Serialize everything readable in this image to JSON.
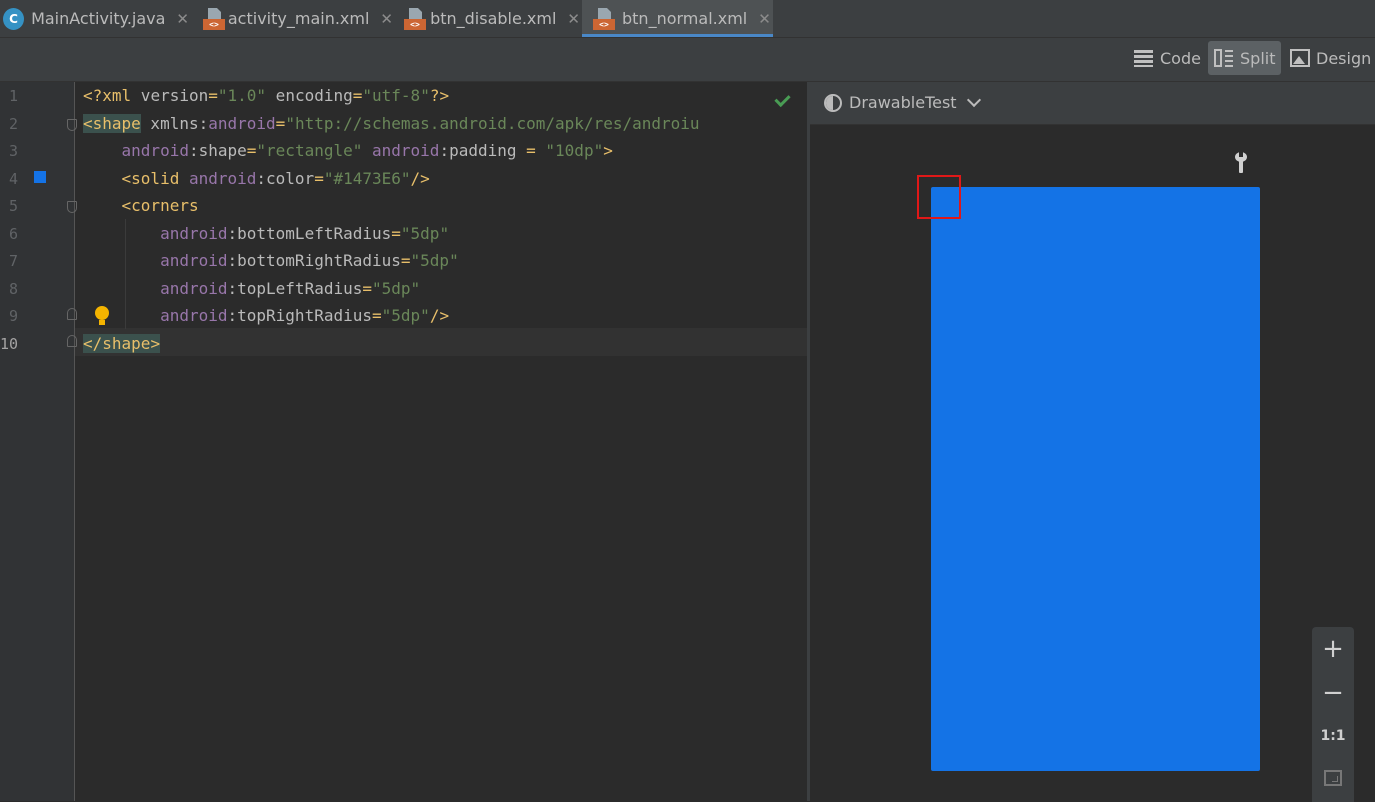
{
  "tabs": [
    {
      "label": "MainActivity.java",
      "icon": "java-class-icon",
      "icon_text": "C"
    },
    {
      "label": "activity_main.xml",
      "icon": "xml-file-icon",
      "icon_text": "<>"
    },
    {
      "label": "btn_disable.xml",
      "icon": "xml-file-icon",
      "icon_text": "<>"
    },
    {
      "label": "btn_normal.xml",
      "icon": "xml-file-icon",
      "icon_text": "<>",
      "active": true
    }
  ],
  "view_modes": {
    "code": "Code",
    "split": "Split",
    "design": "Design",
    "selected": "Split"
  },
  "editor": {
    "line_numbers": [
      "1",
      "2",
      "3",
      "4",
      "5",
      "6",
      "7",
      "8",
      "9",
      "10"
    ],
    "current_line": "10",
    "lines": {
      "l1": {
        "a": "<?xml",
        "b": " version",
        "c": "=",
        "d": "\"1.0\"",
        "e": " encoding",
        "f": "=",
        "g": "\"utf-8\"",
        "h": "?>"
      },
      "l2": {
        "a": "<shape",
        "b": " xmlns:",
        "c": "android",
        "d": "=",
        "e": "\"http://schemas.android.com/apk/res/androiu"
      },
      "l3": {
        "a": "    ",
        "b": "android",
        "c": ":shape",
        "d": "=",
        "e": "\"rectangle\"",
        "f": " android",
        "g": ":padding",
        "h": " = ",
        "i": "\"10dp\"",
        "j": ">"
      },
      "l4": {
        "a": "    ",
        "b": "<solid",
        "c": " android",
        "d": ":color",
        "e": "=",
        "f": "\"#1473E6\"",
        "g": "/>"
      },
      "l5": {
        "a": "    ",
        "b": "<corners"
      },
      "l6": {
        "a": "        ",
        "b": "android",
        "c": ":bottomLeftRadius",
        "d": "=",
        "e": "\"5dp\""
      },
      "l7": {
        "a": "        ",
        "b": "android",
        "c": ":bottomRightRadius",
        "d": "=",
        "e": "\"5dp\""
      },
      "l8": {
        "a": "        ",
        "b": "android",
        "c": ":topLeftRadius",
        "d": "=",
        "e": "\"5dp\""
      },
      "l9": {
        "a": "        ",
        "b": "android",
        "c": ":topRightRadius",
        "d": "=",
        "e": "\"5dp\"",
        "f": "/>"
      },
      "l10": {
        "a": "</shape",
        "b": ">"
      }
    },
    "solid_color": "#1473E6"
  },
  "preview": {
    "theme_label": "DrawableTest",
    "shape_color": "#1473E6",
    "zoom": {
      "plus": "+",
      "minus": "−",
      "one_to_one": "1:1"
    }
  },
  "colors": {
    "accent": "#4a88c7",
    "shape": "#1473E6",
    "selection": "#e01818"
  }
}
